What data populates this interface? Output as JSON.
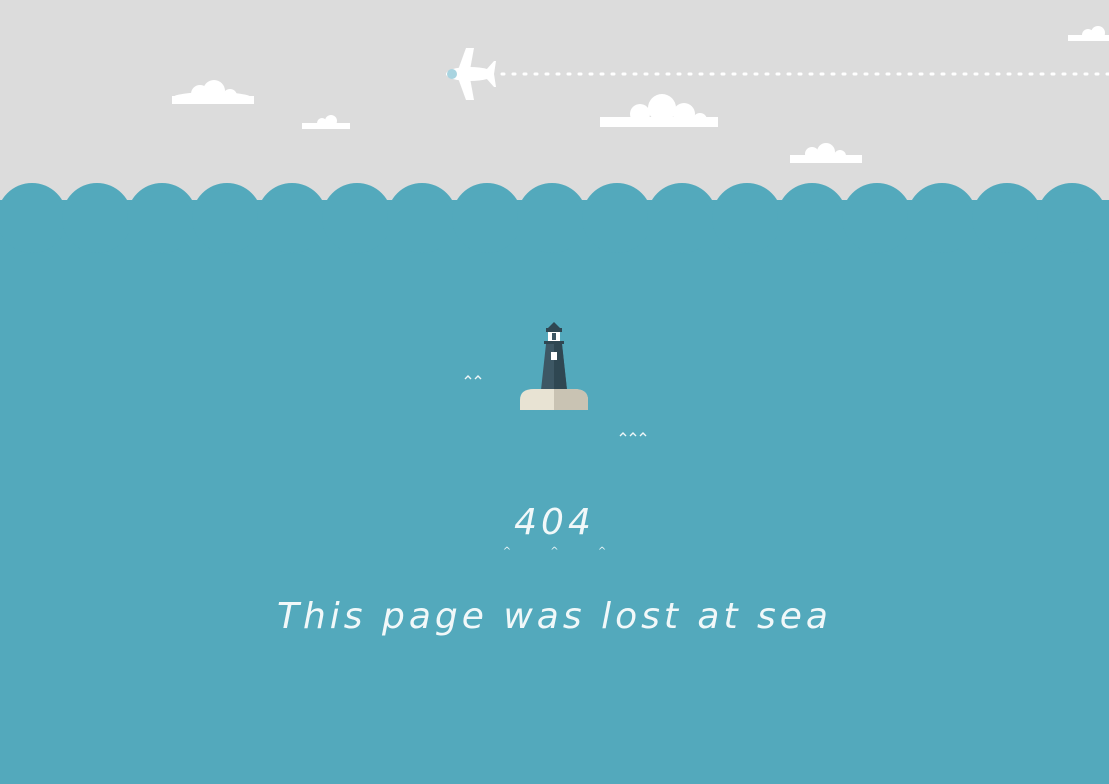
{
  "page": {
    "error_code": "404",
    "message": "This page was lost at sea"
  },
  "icons": {
    "airplane": "airplane-icon",
    "clouds": "cloud-icon",
    "lighthouse": "lighthouse-icon",
    "wave_marks": "wave-marks-icon"
  },
  "colors": {
    "sky": "#dcdcdc",
    "sea": "#53a9bc",
    "wave_crest": "#53a9bc",
    "cloud": "#ffffff",
    "airplane": "#ffffff",
    "lighthouse_tower": "#3d5764",
    "lighthouse_base": "#e8e3d3",
    "text": "#ffffff"
  },
  "decor": {
    "code_waves": "^ ^ ^"
  }
}
